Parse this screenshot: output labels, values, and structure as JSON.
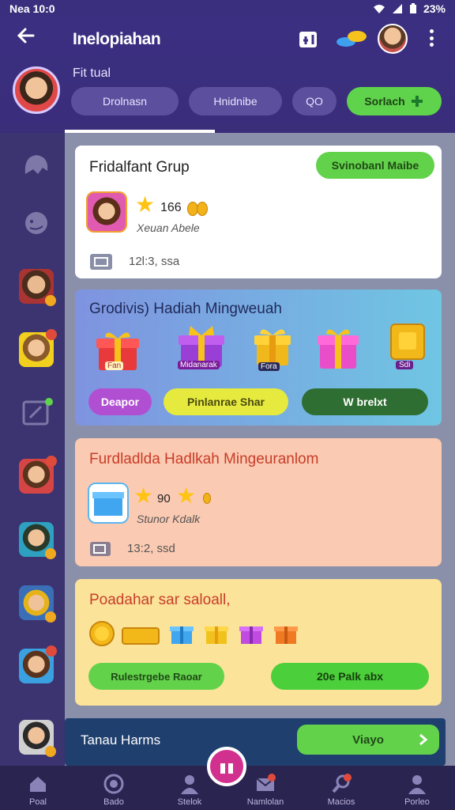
{
  "status_bar": {
    "time": "Nea 10:0",
    "battery": "23%"
  },
  "header": {
    "title": "Inelopiahan",
    "subtitle": "Fit tual",
    "chips": [
      "Drolnasn",
      "Hnidnibe",
      "QO",
      "Sorlach"
    ]
  },
  "cards": {
    "friend_group": {
      "title": "Fridalfant Grup",
      "action": "Svinobanl Maibe",
      "rating": "166",
      "name": "Xeuan Abele",
      "time": "12l:3, ssa"
    },
    "weekly_gift": {
      "title": "Grodivis) Hadiah Mingweuah",
      "gift_labels": [
        "Fan",
        "Midanarak",
        "Fora",
        "",
        "Sdi"
      ],
      "buttons": [
        "Deapor",
        "Pinlanrae Shar",
        "W brelxt"
      ]
    },
    "weekly_reward": {
      "title": "Furdladlda Hadlkah Mingeuranlom",
      "rating": "90",
      "name": "Stunor Kdalk",
      "time": "13:2, ssd"
    },
    "collect": {
      "title": "Poadahar sar saloall,",
      "buttons": [
        "Rulestrgebe Raoar",
        "20e Palk abx"
      ]
    }
  },
  "bottom_banner": {
    "label": "Tanau Harms",
    "button": "Viayo"
  },
  "bottom_nav": [
    "Poal",
    "Bado",
    "Stelok",
    "Namlolan",
    "Macios",
    "Porleo"
  ],
  "colors": {
    "header": "#3b2f82",
    "green": "#5fd34b",
    "sidebar": "#3b3470"
  }
}
